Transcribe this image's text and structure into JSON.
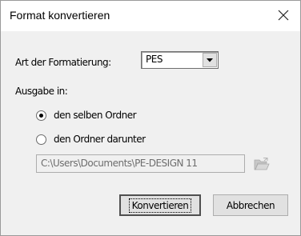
{
  "window": {
    "title": "Format konvertieren",
    "close_icon": "close-icon"
  },
  "format": {
    "label": "Art der Formatierung:",
    "selected": "PES"
  },
  "output": {
    "label": "Ausgabe in:",
    "options": [
      {
        "label": "den selben Ordner",
        "checked": true
      },
      {
        "label": "den Ordner darunter",
        "checked": false
      }
    ],
    "path": "C:\\Users\\Documents\\PE-DESIGN 11",
    "browse_icon": "folder-open-icon"
  },
  "buttons": {
    "convert": "Konvertieren",
    "cancel": "Abbrechen"
  }
}
